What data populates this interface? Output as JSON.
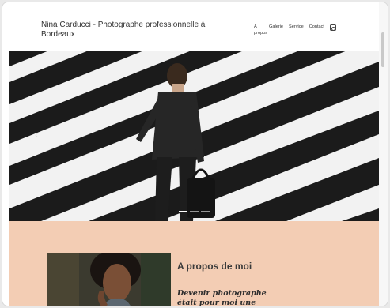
{
  "header": {
    "site_title": "Nina Carducci - Photographe professionnelle à Bordeaux",
    "nav": [
      {
        "label": "À propos"
      },
      {
        "label": "Galerie"
      },
      {
        "label": "Service"
      },
      {
        "label": "Contact"
      }
    ],
    "instagram_icon": "instagram-icon"
  },
  "hero": {
    "carousel_slides": 3,
    "active_slide": 1,
    "prev_icon": "chevron-left-icon"
  },
  "about": {
    "heading": "A propos de moi",
    "tagline": "Devenir photographe était pour moi une évidence"
  },
  "colors": {
    "about_bg": "#f3cdb4",
    "header_bg": "#ffffff"
  }
}
